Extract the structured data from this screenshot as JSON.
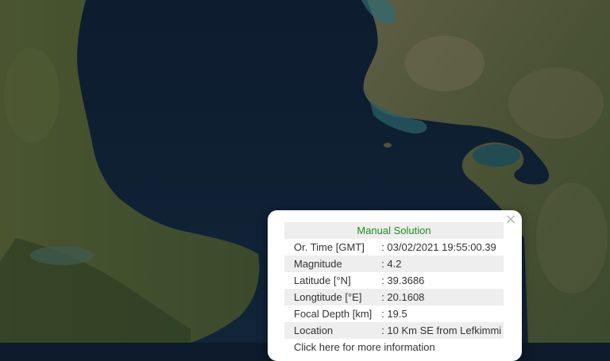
{
  "map": {
    "type": "satellite",
    "colors": {
      "sea": "#0f2033",
      "land_green": "#3b4a2a",
      "land_brown": "#6b6a50",
      "shallow_water": "#2f6a72"
    }
  },
  "popup": {
    "close_symbol": "×",
    "title": "Manual Solution",
    "title_color": "#1e8c1e",
    "rows": [
      {
        "label": "Or. Time [GMT]",
        "value": ": 03/02/2021 19:55:00.39"
      },
      {
        "label": "Magnitude",
        "value": ": 4.2"
      },
      {
        "label": "Latitude [°N]",
        "value": ": 39.3686"
      },
      {
        "label": "Longtitude [°E]",
        "value": ": 20.1608"
      },
      {
        "label": "Focal Depth [km]",
        "value": ": 19.5"
      },
      {
        "label": "Location",
        "value": ": 10 Km SE from Lefkimmi"
      },
      {
        "label": "Click here for more information",
        "value": ""
      }
    ]
  }
}
